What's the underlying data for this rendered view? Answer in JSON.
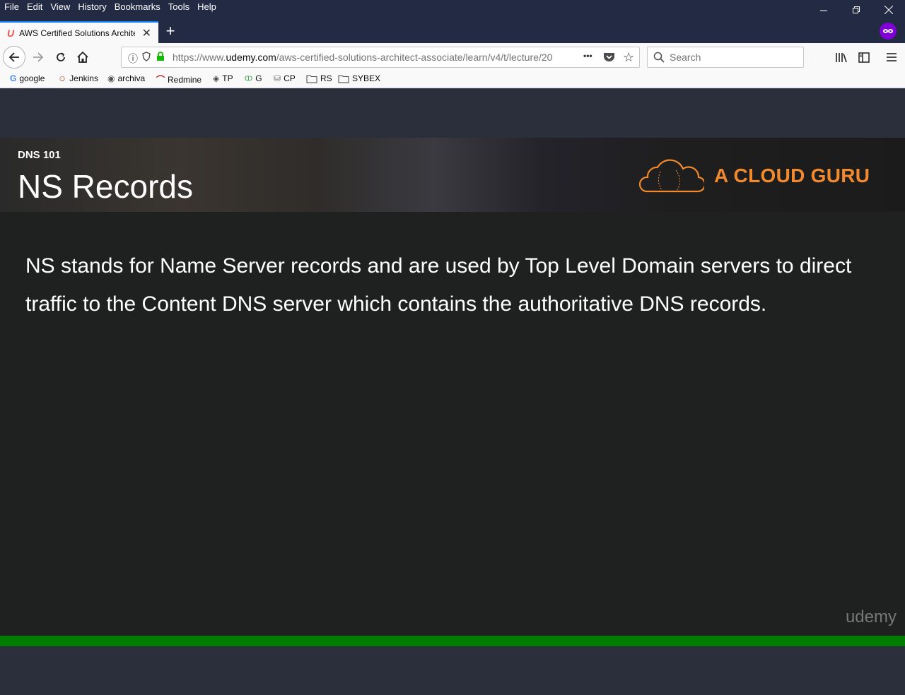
{
  "menubar": {
    "items": [
      "File",
      "Edit",
      "View",
      "History",
      "Bookmarks",
      "Tools",
      "Help"
    ],
    "icons": {
      "minimize": "minimize-icon",
      "restore": "restore-icon",
      "close": "close-icon"
    }
  },
  "tab": {
    "title": "AWS Certified Solutions Architect",
    "favicon": "U",
    "close": "✕",
    "new_tab": "+"
  },
  "navbar": {
    "url_prefix": "https://www.",
    "url_domain": "udemy.com",
    "url_path": "/aws-certified-solutions-architect-associate/learn/v4/t/lecture/20",
    "search_placeholder": "Search",
    "more": "•••"
  },
  "bookmarks": [
    {
      "label": "google",
      "icon": "G"
    },
    {
      "label": "Jenkins",
      "icon": "☺"
    },
    {
      "label": "archiva",
      "icon": "◉"
    },
    {
      "label": "Redmine",
      "icon": "⌒"
    },
    {
      "label": "TP",
      "icon": "◈"
    },
    {
      "label": "G",
      "icon": "ↀ"
    },
    {
      "label": "CP",
      "icon": "⛁"
    },
    {
      "label": "RS",
      "icon": "▭"
    },
    {
      "label": "SYBEX",
      "icon": "▭"
    }
  ],
  "slide": {
    "topic": "DNS 101",
    "heading": "NS Records",
    "logo_text": "A CLOUD GURU",
    "body_line1": "NS stands for Name Server records and are used by Top Level Domain servers to direct",
    "body_line2": "traffic to the Content DNS server which contains the authoritative DNS records.",
    "watermark": "udemy"
  },
  "colors": {
    "accent_orange": "#f2892c",
    "progress_green": "#007c00",
    "titlebar": "#232a44"
  }
}
